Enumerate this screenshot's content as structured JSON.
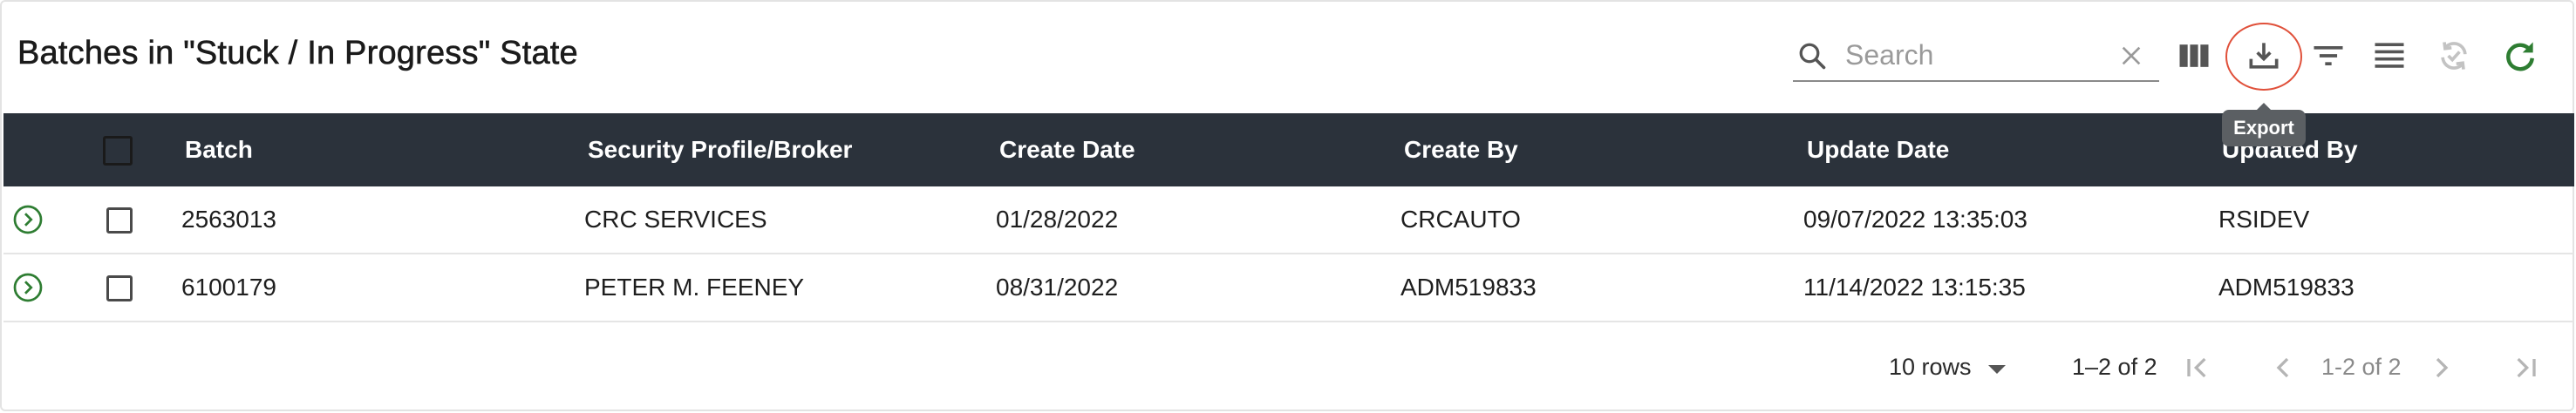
{
  "header": {
    "title": "Batches in \"Stuck / In Progress\" State"
  },
  "search": {
    "placeholder": "Search",
    "value": ""
  },
  "tooltip": {
    "export_label": "Export"
  },
  "colors": {
    "header_bg": "#2b323b",
    "accent_green": "#2e7d32",
    "highlight_ring": "#e0503a"
  },
  "table": {
    "columns": [
      "Batch",
      "Security Profile/Broker",
      "Create Date",
      "Create By",
      "Update Date",
      "Updated By"
    ],
    "rows": [
      [
        "2563013",
        "CRC SERVICES",
        "01/28/2022",
        "CRCAUTO",
        "09/07/2022 13:35:03",
        "RSIDEV"
      ],
      [
        "6100179",
        "PETER M. FEENEY",
        "08/31/2022",
        "ADM519833",
        "11/14/2022 13:15:35",
        "ADM519833"
      ]
    ]
  },
  "pagination": {
    "rows_per_page": "10 rows",
    "range": "1–2 of 2",
    "page_indicator": "1-2 of 2"
  }
}
